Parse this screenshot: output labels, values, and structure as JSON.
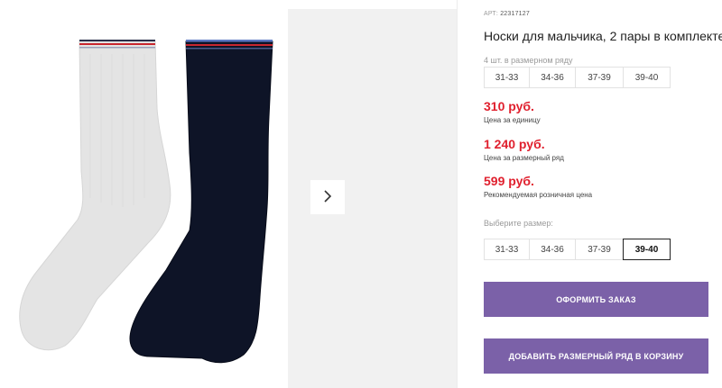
{
  "product": {
    "art_prefix": "АРТ:",
    "art_number": "22317127",
    "title": "Носки для мальчика, 2 пары в комплекте",
    "pack_note": "4 шт. в размерном ряду",
    "pack_sizes": [
      "31-33",
      "34-36",
      "37-39",
      "39-40"
    ]
  },
  "prices": [
    {
      "value": "310 руб.",
      "label": "Цена за единицу"
    },
    {
      "value": "1 240 руб.",
      "label": "Цена за размерный ряд"
    },
    {
      "value": "599 руб.",
      "label": "Рекомендуемая розничная цена"
    }
  ],
  "size_picker": {
    "label": "Выберите размер:",
    "options": [
      "31-33",
      "34-36",
      "37-39",
      "39-40"
    ],
    "selected": "39-40"
  },
  "buttons": {
    "order": "Оформить заказ",
    "add_to_cart": "Добавить размерный ряд в корзину"
  },
  "colors": {
    "accent": "#7b61a8",
    "price": "#e0202e",
    "sock_light": "#e3e3e3",
    "sock_dark": "#0e1427"
  },
  "icons": {
    "next": "chevron-right-icon"
  }
}
